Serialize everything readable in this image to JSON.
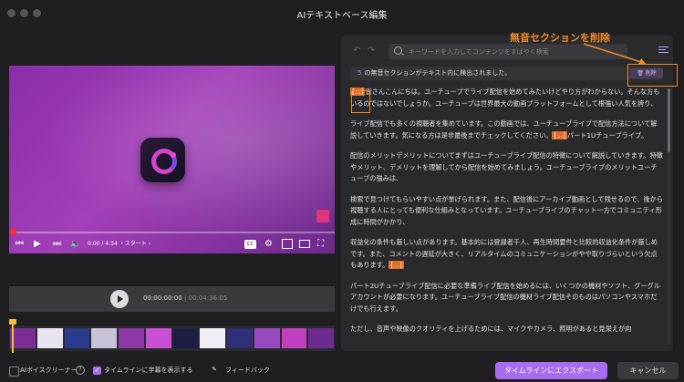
{
  "window": {
    "title": "AIテキストベース編集"
  },
  "video": {
    "time_readout": "0:00 / 4:34 ・スタート ›",
    "cc_label": "CC"
  },
  "player": {
    "current_time": "00:00:00:00",
    "duration": "00:04:36:05"
  },
  "timeline": {
    "thumbnails": [
      {
        "color": "#7a2d96"
      },
      {
        "color": "#e8e4f2"
      },
      {
        "color": "#2a3a8c"
      },
      {
        "color": "#c9c3d8"
      },
      {
        "color": "#8d3aa8"
      },
      {
        "color": "#c94fd4"
      },
      {
        "color": "#1d1d44"
      },
      {
        "color": "#f0eef5"
      },
      {
        "color": "#2f2f7a"
      },
      {
        "color": "#9a4ac0"
      },
      {
        "color": "#c23fc0"
      },
      {
        "color": "#6c2b8e"
      }
    ]
  },
  "editor": {
    "search_placeholder": "キーワードを入力してコンテンツをすばやく検索",
    "notice_count": "5",
    "notice_text": "の無音セクションがテキスト内に検出されました。",
    "delete_label": "削除",
    "paragraphs": [
      {
        "parts": [
          {
            "mark": true,
            "text": "[...]"
          },
          {
            "text": "皆さんこんにちは。ユーチューブでライブ配信を始めてみたいけどやり方がわからない。そんな方もいるのではないでしょうか。ユーチューブは世界最大の動画プラットフォームとして根強い人気を誇り、"
          }
        ]
      },
      {
        "parts": [
          {
            "text": "ライブ配信でも多くの視聴者を集めています。この動画では、ユーチューブライブで配信方法について解説していきます。気になる方は是非最後までチェックしてください。"
          },
          {
            "mark": true,
            "text": "[...]"
          },
          {
            "text": "パート1Uチューブライブ。"
          }
        ]
      },
      {
        "parts": [
          {
            "text": "配信のメリットデメリットについてまずはユーチューブライブ配信の特徴について解説していきます。特徴やメリット、デメリットを理解してから配信を始めてみましょう。ユーチューブライブのメリットユーチューブの強みは、"
          }
        ]
      },
      {
        "parts": [
          {
            "text": "検索で見つけてもらいやすい点が挙げられます。また、配信後にアーカイブ動画として残せるので、後から視聴する人にとっても便利な仕組みとなっています。ユーチューブライブのチャット一方でコミュニティ形成に時間がかかり、"
          }
        ]
      },
      {
        "parts": [
          {
            "text": "収益化の条件も厳しい点があります。基本的には登録者千人、再生時間要件と比較的収益化条件が厳しめです。また、コメントの遅延が大きく、リアルタイムのコミュニケーションがやや取りづらいという欠点もあります。"
          },
          {
            "mark": true,
            "text": "[...]"
          }
        ]
      },
      {
        "parts": [
          {
            "text": "パート2Uチューブライブ配信に必要な準備ライブ配信を始めるには、いくつかの機材やソフト、グーグルアカウントが必要になります。ユーチューブライブ配信の機材ライブ配信そのものはパソコンやスマホだけでも行えます。"
          }
        ]
      },
      {
        "parts": [
          {
            "text": "ただし、音声や映像のクオリティを上げるためには、マイクやカメラ、照明があると見栄えが向"
          }
        ]
      }
    ]
  },
  "annotation": {
    "label": "無音セクションを削除",
    "color": "#f08a2a"
  },
  "bottom": {
    "ai_cleaner_label": "AIボイスクリーナー",
    "subtitle_label": "タイムラインに字幕を表示する",
    "feedback_label": "フィードバック",
    "export_label": "タイムラインにエクスポート",
    "cancel_label": "キャンセル"
  }
}
